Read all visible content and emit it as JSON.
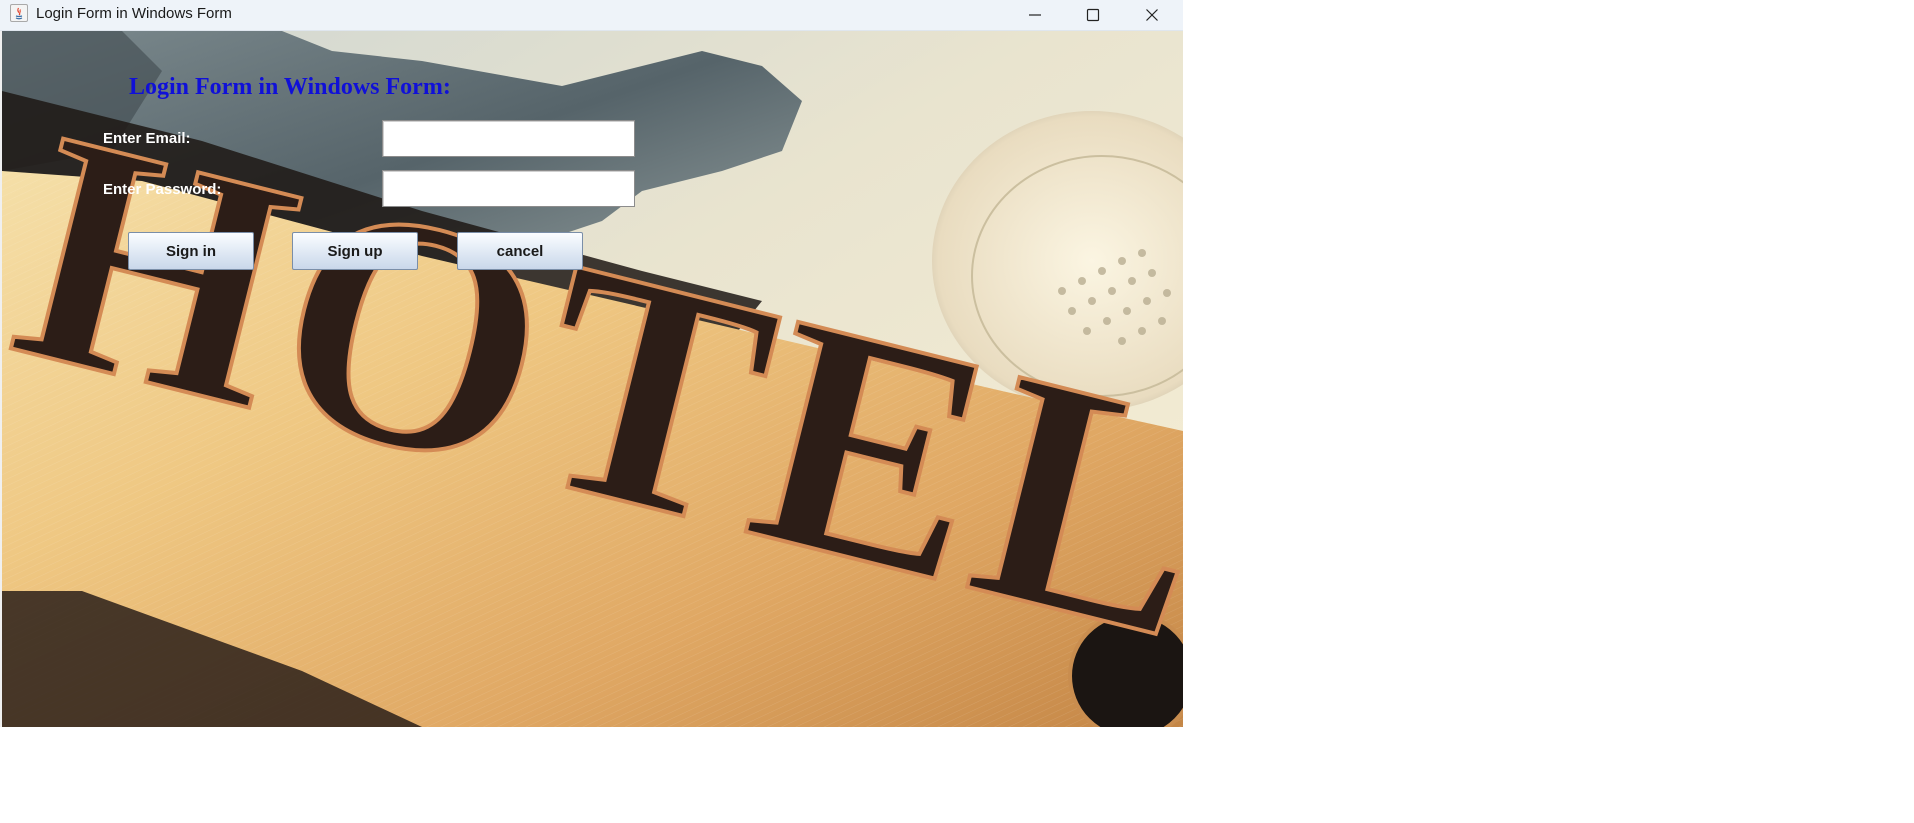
{
  "window": {
    "title": "Login Form in Windows Form",
    "controls": {
      "minimize_icon": "minimize-icon",
      "maximize_icon": "maximize-icon",
      "close_icon": "close-icon"
    }
  },
  "form": {
    "heading": "Login Form in Windows Form:",
    "email_label": "Enter Email:",
    "email_value": "",
    "password_label": "Enter Password:",
    "password_value": "",
    "buttons": {
      "sign_in": "Sign in",
      "sign_up": "Sign up",
      "cancel": "cancel"
    }
  },
  "background": {
    "sign_text": "HOTEL"
  },
  "colors": {
    "heading": "#1010d8",
    "label": "#ffffff",
    "titlebar": "#eef3f9"
  }
}
